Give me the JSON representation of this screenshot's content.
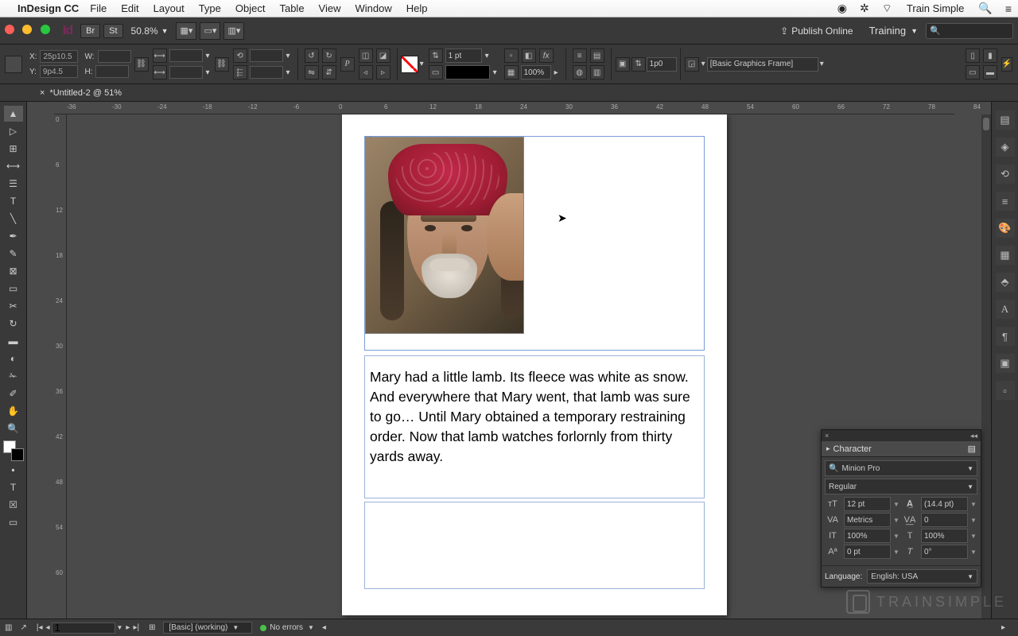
{
  "menubar": {
    "app_name": "InDesign CC",
    "items": [
      "File",
      "Edit",
      "Layout",
      "Type",
      "Object",
      "Table",
      "View",
      "Window",
      "Help"
    ],
    "user": "Train Simple"
  },
  "appbar": {
    "br_label": "Br",
    "st_label": "St",
    "zoom": "50.8%",
    "publish": "Publish Online",
    "workspace": "Training"
  },
  "control": {
    "x": "25p10.5",
    "y": "9p4.5",
    "w": "",
    "h": "",
    "stroke_weight": "1 pt",
    "gap": "1p0",
    "opacity": "100%",
    "style_dd": "[Basic Graphics Frame]"
  },
  "doc_tab": "*Untitled-2 @ 51%",
  "ruler_h": [
    "-36",
    "-30",
    "-24",
    "-18",
    "-12",
    "-6",
    "0",
    "6",
    "12",
    "18",
    "24",
    "30",
    "36",
    "42",
    "48",
    "54",
    "60",
    "66",
    "72",
    "78",
    "84"
  ],
  "ruler_v": [
    "0",
    "6",
    "12",
    "18",
    "24",
    "30",
    "36",
    "42",
    "48",
    "54",
    "60"
  ],
  "page": {
    "body_text": "Mary had a little lamb. Its fleece was white as snow. And everywhere that Mary went, that lamb was sure to go… Until Mary obtained a temporary restraining order. Now that lamb watches forlornly from thirty yards away."
  },
  "status": {
    "page_field": "1",
    "preset": "[Basic] (working)",
    "preflight": "No errors"
  },
  "char_panel": {
    "title": "Character",
    "font": "Minion Pro",
    "style": "Regular",
    "size": "12 pt",
    "leading": "(14.4 pt)",
    "kerning": "Metrics",
    "tracking": "0",
    "vscale": "100%",
    "hscale": "100%",
    "baseline": "0 pt",
    "skew": "0°",
    "lang_label": "Language:",
    "lang": "English: USA"
  },
  "watermark": "TRAINSIMPLE"
}
